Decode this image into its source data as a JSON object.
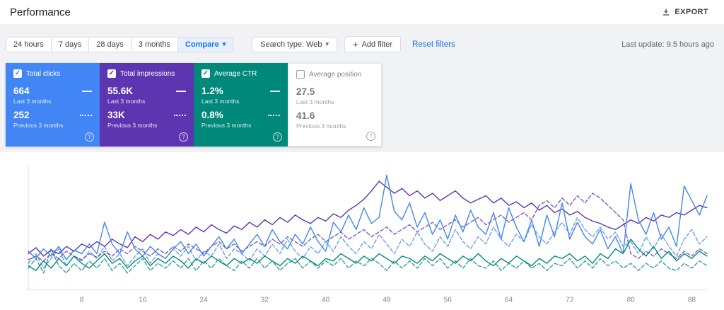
{
  "header": {
    "title": "Performance",
    "export_label": "EXPORT"
  },
  "toolbar": {
    "date_tabs": [
      "24 hours",
      "7 days",
      "28 days",
      "3 months"
    ],
    "compare_label": "Compare",
    "search_type_label": "Search type: Web",
    "add_filter_label": "Add filter",
    "reset_filters_label": "Reset filters",
    "last_update": "Last update: 9.5 hours ago"
  },
  "icons": {
    "caret": "▾",
    "plus": "+",
    "help": "?",
    "check": "✓"
  },
  "metric_cards": [
    {
      "label": "Total clicks",
      "checked": true,
      "color": "#4285f4",
      "current_value": "664",
      "current_label": "Last 3 months",
      "previous_value": "252",
      "previous_label": "Previous 3 months"
    },
    {
      "label": "Total impressions",
      "checked": true,
      "color": "#5e35b1",
      "current_value": "55.6K",
      "current_label": "Last 3 months",
      "previous_value": "33K",
      "previous_label": "Previous 3 months"
    },
    {
      "label": "Average CTR",
      "checked": true,
      "color": "#00897b",
      "current_value": "1.2%",
      "current_label": "Last 3 months",
      "previous_value": "0.8%",
      "previous_label": "Previous 3 months"
    },
    {
      "label": "Average position",
      "checked": false,
      "color": "#ffffff",
      "current_value": "27.5",
      "current_label": "Last 3 months",
      "previous_value": "41.6",
      "previous_label": "Previous 3 months"
    }
  ],
  "chart_data": {
    "type": "line",
    "x_range": [
      1,
      90
    ],
    "x_ticks": [
      8,
      16,
      24,
      32,
      40,
      48,
      56,
      64,
      72,
      80,
      88
    ],
    "y_note": "values are estimated percent of plot height (no y-axis labels visible)",
    "legend_position": "none (legend lives in the metric tiles)",
    "grid": "left and bottom axis lines only",
    "series": [
      {
        "name": "Clicks - Previous 3 months",
        "color": "#4285f4",
        "style": "dashed",
        "values": [
          22,
          30,
          18,
          26,
          34,
          20,
          28,
          24,
          32,
          26,
          36,
          24,
          30,
          20,
          28,
          34,
          22,
          30,
          26,
          34,
          28,
          36,
          24,
          32,
          28,
          38,
          26,
          34,
          30,
          24,
          34,
          28,
          38,
          30,
          42,
          32,
          26,
          36,
          30,
          40,
          32,
          44,
          36,
          30,
          40,
          34,
          46,
          38,
          30,
          42,
          36,
          48,
          38,
          32,
          44,
          36,
          50,
          40,
          34,
          44,
          38,
          52,
          42,
          36,
          46,
          40,
          54,
          44,
          38,
          48,
          56,
          46,
          60,
          50,
          44,
          52,
          42,
          48,
          36,
          40,
          30,
          44,
          34,
          46,
          36,
          28,
          42,
          50,
          38,
          44
        ]
      },
      {
        "name": "Impressions - Previous 3 months",
        "color": "#5e35b1",
        "style": "dashed",
        "values": [
          25,
          28,
          24,
          30,
          26,
          32,
          28,
          25,
          30,
          27,
          32,
          28,
          34,
          30,
          36,
          32,
          28,
          34,
          30,
          36,
          32,
          38,
          34,
          30,
          36,
          40,
          34,
          38,
          32,
          36,
          40,
          36,
          42,
          38,
          44,
          40,
          36,
          42,
          46,
          40,
          44,
          48,
          42,
          46,
          50,
          44,
          48,
          52,
          46,
          50,
          54,
          48,
          52,
          56,
          50,
          54,
          58,
          52,
          56,
          60,
          54,
          58,
          62,
          56,
          60,
          64,
          58,
          70,
          74,
          68,
          76,
          70,
          78,
          72,
          80,
          76,
          70,
          64,
          58,
          30,
          26,
          32,
          28,
          34,
          30,
          26,
          32,
          28,
          34,
          30
        ]
      },
      {
        "name": "CTR - Previous 3 months",
        "color": "#00897b",
        "style": "dashed",
        "values": [
          18,
          26,
          14,
          34,
          20,
          14,
          22,
          16,
          24,
          18,
          26,
          16,
          22,
          14,
          20,
          26,
          16,
          22,
          18,
          24,
          18,
          26,
          16,
          24,
          18,
          26,
          20,
          16,
          24,
          18,
          26,
          18,
          24,
          16,
          22,
          26,
          18,
          24,
          18,
          24,
          20,
          26,
          18,
          24,
          20,
          26,
          22,
          16,
          24,
          18,
          24,
          18,
          26,
          20,
          26,
          18,
          24,
          18,
          26,
          20,
          18,
          24,
          16,
          22,
          18,
          24,
          18,
          22,
          16,
          22,
          20,
          26,
          18,
          24,
          18,
          26,
          20,
          24,
          18,
          22,
          16,
          22,
          18,
          24,
          18,
          16,
          22,
          18,
          24,
          20
        ]
      },
      {
        "name": "Impressions - Last 3 months",
        "color": "#5e35b1",
        "style": "solid",
        "values": [
          30,
          35,
          28,
          33,
          30,
          36,
          32,
          38,
          35,
          40,
          36,
          42,
          38,
          35,
          44,
          40,
          46,
          42,
          48,
          45,
          50,
          46,
          52,
          48,
          54,
          50,
          47,
          53,
          50,
          56,
          52,
          58,
          54,
          60,
          56,
          62,
          58,
          55,
          60,
          57,
          63,
          60,
          66,
          70,
          75,
          82,
          90,
          85,
          80,
          84,
          78,
          82,
          76,
          80,
          74,
          78,
          82,
          76,
          72,
          75,
          78,
          72,
          76,
          70,
          73,
          68,
          72,
          66,
          70,
          64,
          67,
          62,
          65,
          60,
          57,
          55,
          52,
          50,
          54,
          58,
          55,
          60,
          57,
          62,
          60,
          64,
          62,
          66,
          70,
          68
        ]
      },
      {
        "name": "CTR - Last 3 months",
        "color": "#00897b",
        "style": "solid",
        "values": [
          20,
          16,
          24,
          18,
          26,
          20,
          28,
          22,
          18,
          24,
          30,
          22,
          26,
          18,
          24,
          28,
          20,
          26,
          22,
          28,
          24,
          18,
          26,
          22,
          28,
          24,
          20,
          26,
          22,
          26,
          22,
          28,
          24,
          20,
          26,
          22,
          28,
          24,
          20,
          26,
          24,
          30,
          26,
          22,
          28,
          24,
          30,
          26,
          22,
          28,
          26,
          22,
          28,
          24,
          30,
          26,
          22,
          28,
          24,
          30,
          24,
          20,
          26,
          22,
          28,
          24,
          20,
          26,
          22,
          28,
          26,
          30,
          24,
          28,
          22,
          30,
          26,
          34,
          30,
          42,
          34,
          28,
          36,
          26,
          32,
          24,
          30,
          26,
          32,
          28
        ]
      },
      {
        "name": "Clicks - Last 3 months",
        "color": "#4285f4",
        "style": "solid",
        "values": [
          32,
          26,
          34,
          28,
          36,
          25,
          33,
          30,
          38,
          30,
          56,
          38,
          30,
          48,
          34,
          28,
          36,
          30,
          26,
          34,
          40,
          30,
          38,
          28,
          36,
          44,
          34,
          42,
          30,
          38,
          46,
          36,
          50,
          40,
          34,
          46,
          38,
          52,
          40,
          32,
          56,
          48,
          62,
          50,
          68,
          55,
          60,
          95,
          65,
          58,
          72,
          52,
          64,
          46,
          58,
          42,
          62,
          48,
          66,
          52,
          46,
          64,
          42,
          68,
          52,
          40,
          58,
          36,
          62,
          44,
          72,
          42,
          56,
          44,
          38,
          50,
          34,
          44,
          30,
          88,
          58,
          46,
          64,
          42,
          52,
          36,
          86,
          74,
          62,
          78
        ]
      }
    ]
  }
}
